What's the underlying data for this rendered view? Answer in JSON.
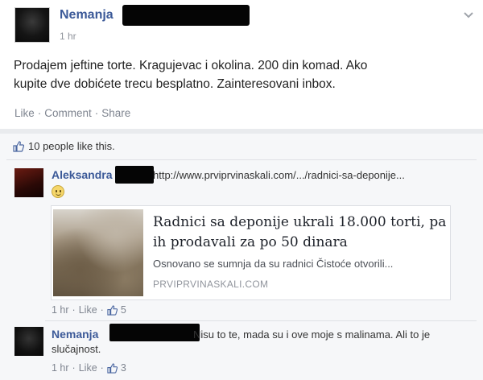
{
  "post": {
    "author": "Nemanja",
    "time": "1 hr",
    "text": "Prodajem jeftine torte. Kragujevac i okolina. 200 din komad. Ako kupite dve dobićete trecu besplatno. Zainteresovani inbox.",
    "actions": {
      "like": "Like",
      "sep": "·",
      "comment": "Comment",
      "share": "Share"
    }
  },
  "likes": {
    "text": "10 people like this."
  },
  "comments": [
    {
      "author": "Aleksandra",
      "link": "http://www.prviprvinaskali.com/.../radnici-sa-deponije...",
      "emoji": "smile",
      "card": {
        "title": "Radnici sa deponije ukrali 18.000 torti, pa ih prodavali za po 50 dinara",
        "description": "Osnovano se sumnja da su radnici Čistoće otvorili...",
        "domain": "PRVIPRVINASKALI.COM"
      },
      "time": "1 hr",
      "like": "Like",
      "likes": "5"
    },
    {
      "author": "Nemanja",
      "text_line1": "Nisu to te, mada su i ove moje s malinama. Ali to je",
      "text_line2": "slučajnost.",
      "time": "1 hr",
      "like": "Like",
      "likes": "3"
    }
  ],
  "icons": {
    "chevron": "chevron-down-icon",
    "like": "like-icon",
    "emoji": "smile-emoji-icon"
  },
  "colors": {
    "name": "#3b5998",
    "meta": "#90949c",
    "background": "#f6f7f9"
  }
}
